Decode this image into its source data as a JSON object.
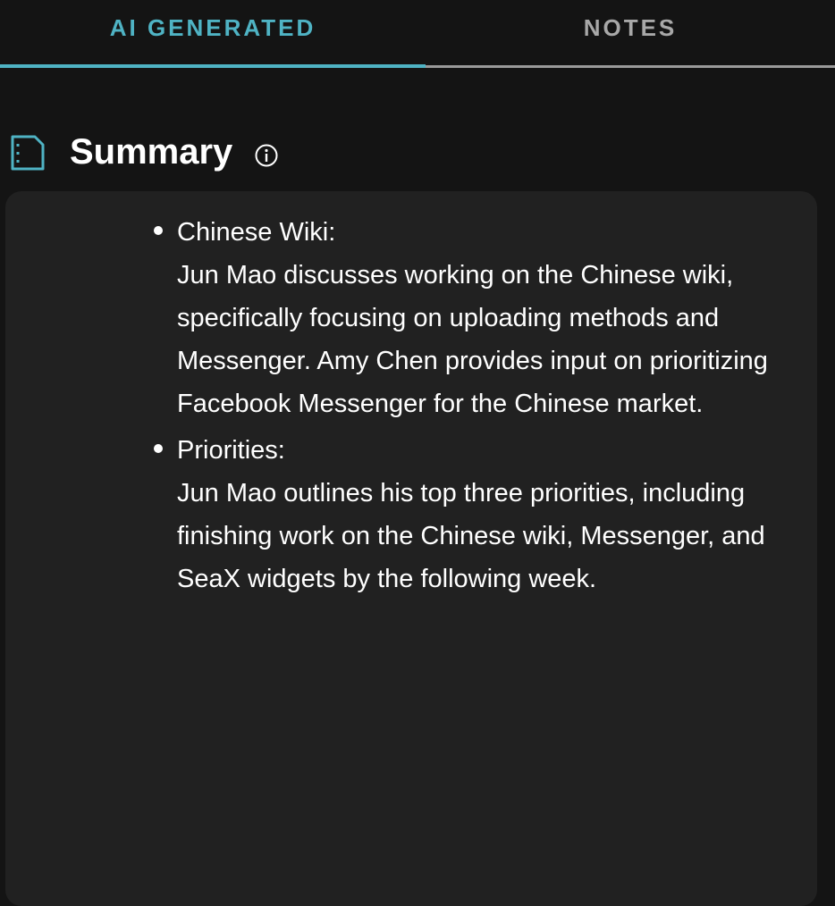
{
  "tabs": {
    "ai_generated": "AI GENERATED",
    "notes": "NOTES",
    "active": "ai_generated"
  },
  "summary": {
    "title": "Summary",
    "icon": "document-icon",
    "info_icon": "info-icon",
    "items": [
      {
        "heading": "Chinese Wiki:",
        "text": "Jun Mao discusses working on the Chinese wiki, specifically focusing on uploading methods and Messenger. Amy Chen provides input on prioritizing Facebook Messenger for the Chinese market."
      },
      {
        "heading": "Priorities:",
        "text": "Jun Mao outlines his top three priorities, including finishing work on the Chinese wiki, Messenger, and SeaX widgets by the following week."
      }
    ]
  },
  "colors": {
    "accent": "#4fb3c4",
    "background": "#141414",
    "card": "#212121",
    "inactive_tab": "#a8a8a8"
  }
}
